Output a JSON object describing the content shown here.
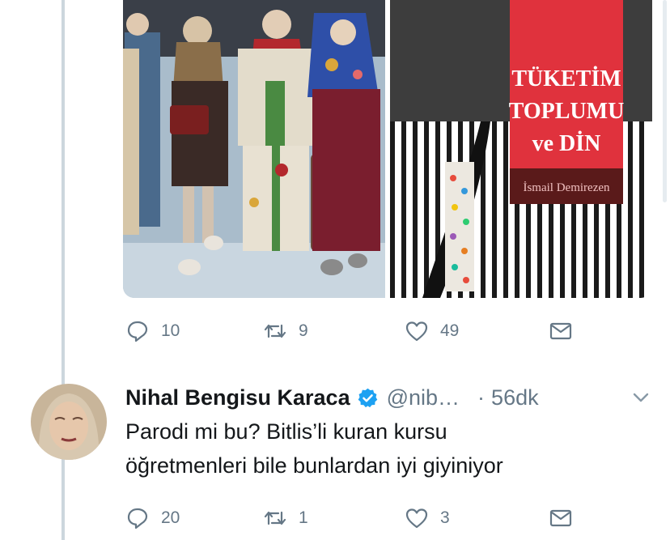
{
  "tweet1": {
    "actions": {
      "reply_count": "10",
      "retweet_count": "9",
      "like_count": "49"
    },
    "book_cover": {
      "title_line1": "TÜKETİM",
      "title_line2": "TOPLUMU",
      "title_line3": "ve DİN",
      "author": "İsmail Demirezen"
    }
  },
  "tweet2": {
    "author_name": "Nihal Bengisu Karaca",
    "handle": "@nib…",
    "separator": "·",
    "time": "56dk",
    "text_line1": "Parodi mi bu? Bitlis’li kuran kursu",
    "text_line2": "öğretmenleri bile bunlardan iyi giyiniyor",
    "actions": {
      "reply_count": "20",
      "retweet_count": "1",
      "like_count": "3"
    }
  },
  "icons": {
    "reply": "reply-icon",
    "retweet": "retweet-icon",
    "like": "heart-icon",
    "dm": "envelope-icon",
    "verified": "verified-badge-icon",
    "more": "chevron-down-icon"
  },
  "colors": {
    "icon_gray": "#657786",
    "verified_blue": "#1da1f2",
    "book_red": "#e0323d",
    "thread_line": "#ccd6dd"
  }
}
